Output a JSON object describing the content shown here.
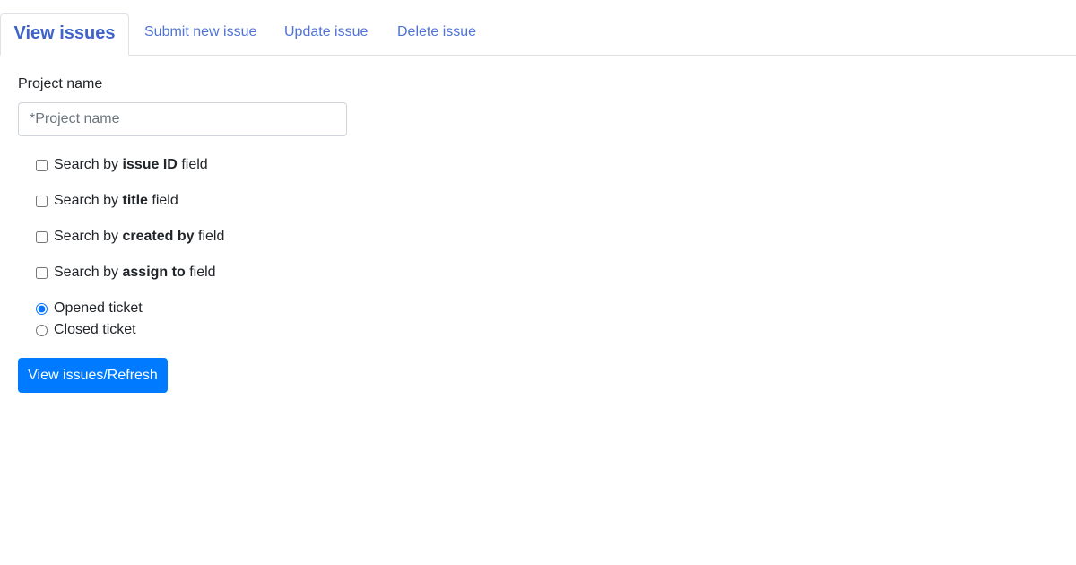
{
  "tabs": [
    {
      "label": "View issues",
      "active": true
    },
    {
      "label": "Submit new issue",
      "active": false
    },
    {
      "label": "Update issue",
      "active": false
    },
    {
      "label": "Delete issue",
      "active": false
    }
  ],
  "form": {
    "project_label": "Project name",
    "project_value": "",
    "project_placeholder": "*Project name",
    "search_options": [
      {
        "prefix": "Search by",
        "field": "issue ID",
        "suffix": "field",
        "checked": false
      },
      {
        "prefix": "Search by",
        "field": "title",
        "suffix": "field",
        "checked": false
      },
      {
        "prefix": "Search by",
        "field": "created by",
        "suffix": "field",
        "checked": false
      },
      {
        "prefix": "Search by",
        "field": "assign to",
        "suffix": "field",
        "checked": false
      }
    ],
    "status_options": [
      {
        "label": "Opened ticket",
        "selected": true
      },
      {
        "label": "Closed ticket",
        "selected": false
      }
    ],
    "submit_label": "View issues/Refresh"
  },
  "colors": {
    "accent": "#007bff",
    "tab_link": "#4f73d6",
    "border": "#dee2e6"
  }
}
